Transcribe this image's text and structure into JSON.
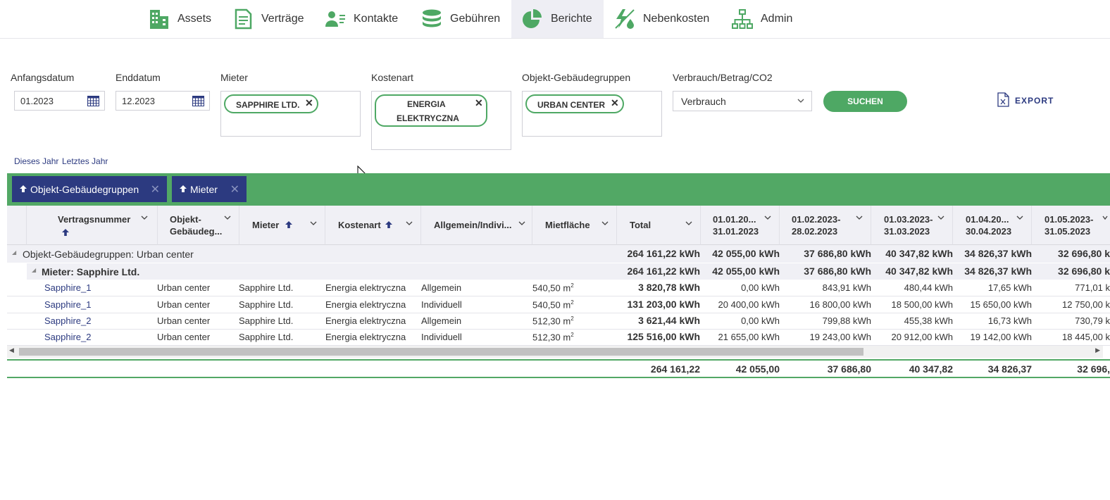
{
  "nav": {
    "items": [
      {
        "label": "Assets",
        "icon": "building-icon"
      },
      {
        "label": "Verträge",
        "icon": "document-icon"
      },
      {
        "label": "Kontakte",
        "icon": "contact-icon"
      },
      {
        "label": "Gebühren",
        "icon": "coins-icon"
      },
      {
        "label": "Berichte",
        "icon": "pie-chart-icon",
        "active": true
      },
      {
        "label": "Nebenkosten",
        "icon": "utilities-icon"
      },
      {
        "label": "Admin",
        "icon": "org-chart-icon"
      }
    ]
  },
  "filters": {
    "start_label": "Anfangsdatum",
    "start_value": "01.2023",
    "end_label": "Enddatum",
    "end_value": "12.2023",
    "tenant_label": "Mieter",
    "tenant_chip": "Sapphire Ltd.",
    "costtype_label": "Kostenart",
    "costtype_chip_line1": "Energia",
    "costtype_chip_line2": "elektryczna",
    "group_label": "Objekt-Gebäudegruppen",
    "group_chip": "Urban center",
    "mode_label": "Verbrauch/Betrag/CO2",
    "mode_value": "Verbrauch",
    "search_label": "SUCHEN",
    "export_label": "EXPORT",
    "quick_this_year": "Dieses Jahr",
    "quick_last_year": "Letztes Jahr"
  },
  "grouping": {
    "chips": [
      "Objekt-Gebäudegruppen",
      "Mieter"
    ]
  },
  "columns": {
    "contract": "Vertragsnummer",
    "object_l1": "Objekt-",
    "object_l2": "Gebäudeg...",
    "tenant": "Mieter",
    "costtype": "Kostenart",
    "general": "Allgemein/Indivi...",
    "area": "Mietfläche",
    "total": "Total",
    "m1_l1": "01.01.20...",
    "m1_l2": "31.01.2023",
    "m2_l1": "01.02.2023-",
    "m2_l2": "28.02.2023",
    "m3_l1": "01.03.2023-",
    "m3_l2": "31.03.2023",
    "m4_l1": "01.04.20...",
    "m4_l2": "30.04.2023",
    "m5_l1": "01.05.2023-",
    "m5_l2": "31.05.2023"
  },
  "groups": {
    "g1_label": "Objekt-Gebäudegruppen: Urban center",
    "g1_total": "264 161,22 kWh",
    "g1_m1": "42 055,00 kWh",
    "g1_m2": "37 686,80 kWh",
    "g1_m3": "40 347,82 kWh",
    "g1_m4": "34 826,37 kWh",
    "g1_m5": "32 696,80 k",
    "g2_label": "Mieter: Sapphire Ltd.",
    "g2_total": "264 161,22 kWh",
    "g2_m1": "42 055,00 kWh",
    "g2_m2": "37 686,80 kWh",
    "g2_m3": "40 347,82 kWh",
    "g2_m4": "34 826,37 kWh",
    "g2_m5": "32 696,80 k"
  },
  "rows": [
    {
      "contract": "Sapphire_1",
      "object": "Urban center",
      "tenant": "Sapphire Ltd.",
      "costtype": "Energia elektryczna",
      "general": "Allgemein",
      "area": "540,50 m",
      "total": "3 820,78 kWh",
      "m1": "0,00 kWh",
      "m2": "843,91 kWh",
      "m3": "480,44 kWh",
      "m4": "17,65 kWh",
      "m5": "771,01 k"
    },
    {
      "contract": "Sapphire_1",
      "object": "Urban center",
      "tenant": "Sapphire Ltd.",
      "costtype": "Energia elektryczna",
      "general": "Individuell",
      "area": "540,50 m",
      "total": "131 203,00 kWh",
      "m1": "20 400,00 kWh",
      "m2": "16 800,00 kWh",
      "m3": "18 500,00 kWh",
      "m4": "15 650,00 kWh",
      "m5": "12 750,00 k"
    },
    {
      "contract": "Sapphire_2",
      "object": "Urban center",
      "tenant": "Sapphire Ltd.",
      "costtype": "Energia elektryczna",
      "general": "Allgemein",
      "area": "512,30 m",
      "total": "3 621,44 kWh",
      "m1": "0,00 kWh",
      "m2": "799,88 kWh",
      "m3": "455,38 kWh",
      "m4": "16,73 kWh",
      "m5": "730,79 k"
    },
    {
      "contract": "Sapphire_2",
      "object": "Urban center",
      "tenant": "Sapphire Ltd.",
      "costtype": "Energia elektryczna",
      "general": "Individuell",
      "area": "512,30 m",
      "total": "125 516,00 kWh",
      "m1": "21 655,00 kWh",
      "m2": "19 243,00 kWh",
      "m3": "20 912,00 kWh",
      "m4": "19 142,00 kWh",
      "m5": "18 445,00 k"
    }
  ],
  "area_unit_sup": "2",
  "footer": {
    "total": "264 161,22",
    "m1": "42 055,00",
    "m2": "37 686,80",
    "m3": "40 347,82",
    "m4": "34 826,37",
    "m5": "32 696,"
  },
  "colors": {
    "brand_green": "#4ea864",
    "navy": "#2c3a80",
    "header_bg": "#f0f0f5"
  }
}
